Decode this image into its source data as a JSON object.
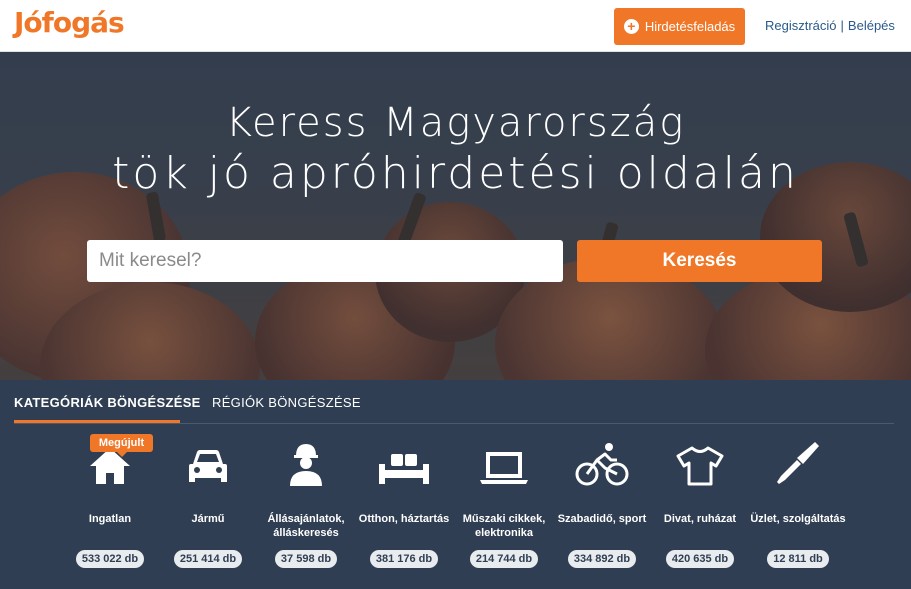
{
  "header": {
    "logo": "Jófogás",
    "post_button": "Hirdetésfeladás",
    "register": "Regisztráció",
    "separator": "|",
    "login": "Belépés"
  },
  "hero": {
    "headline_line1": "Keress Magyarország",
    "headline_line2": "tök jó apróhirdetési oldalán",
    "search_placeholder": "Mit keresel?",
    "search_value": "",
    "search_button": "Keresés"
  },
  "tabs": {
    "categories": "KATEGÓRIÁK BÖNGÉSZÉSE",
    "regions": "RÉGIÓK BÖNGÉSZÉSE"
  },
  "badge": "Megújult",
  "categories": [
    {
      "label": "Ingatlan",
      "count": "533 022 db",
      "icon": "house-icon"
    },
    {
      "label": "Jármű",
      "count": "251 414 db",
      "icon": "car-icon"
    },
    {
      "label": "Állásajánlatok, álláskeresés",
      "count": "37 598 db",
      "icon": "worker-icon"
    },
    {
      "label": "Otthon, háztartás",
      "count": "381 176 db",
      "icon": "sofa-icon"
    },
    {
      "label": "Műszaki cikkek, elektronika",
      "count": "214 744 db",
      "icon": "laptop-icon"
    },
    {
      "label": "Szabadidő, sport",
      "count": "334 892 db",
      "icon": "bicycle-icon"
    },
    {
      "label": "Divat, ruházat",
      "count": "420 635 db",
      "icon": "tshirt-icon"
    },
    {
      "label": "Üzlet, szolgáltatás",
      "count": "12 811 db",
      "icon": "screwdriver-icon"
    }
  ],
  "colors": {
    "accent": "#f07727",
    "panel_bg": "#2f3e52",
    "link": "#2a5a8a"
  }
}
